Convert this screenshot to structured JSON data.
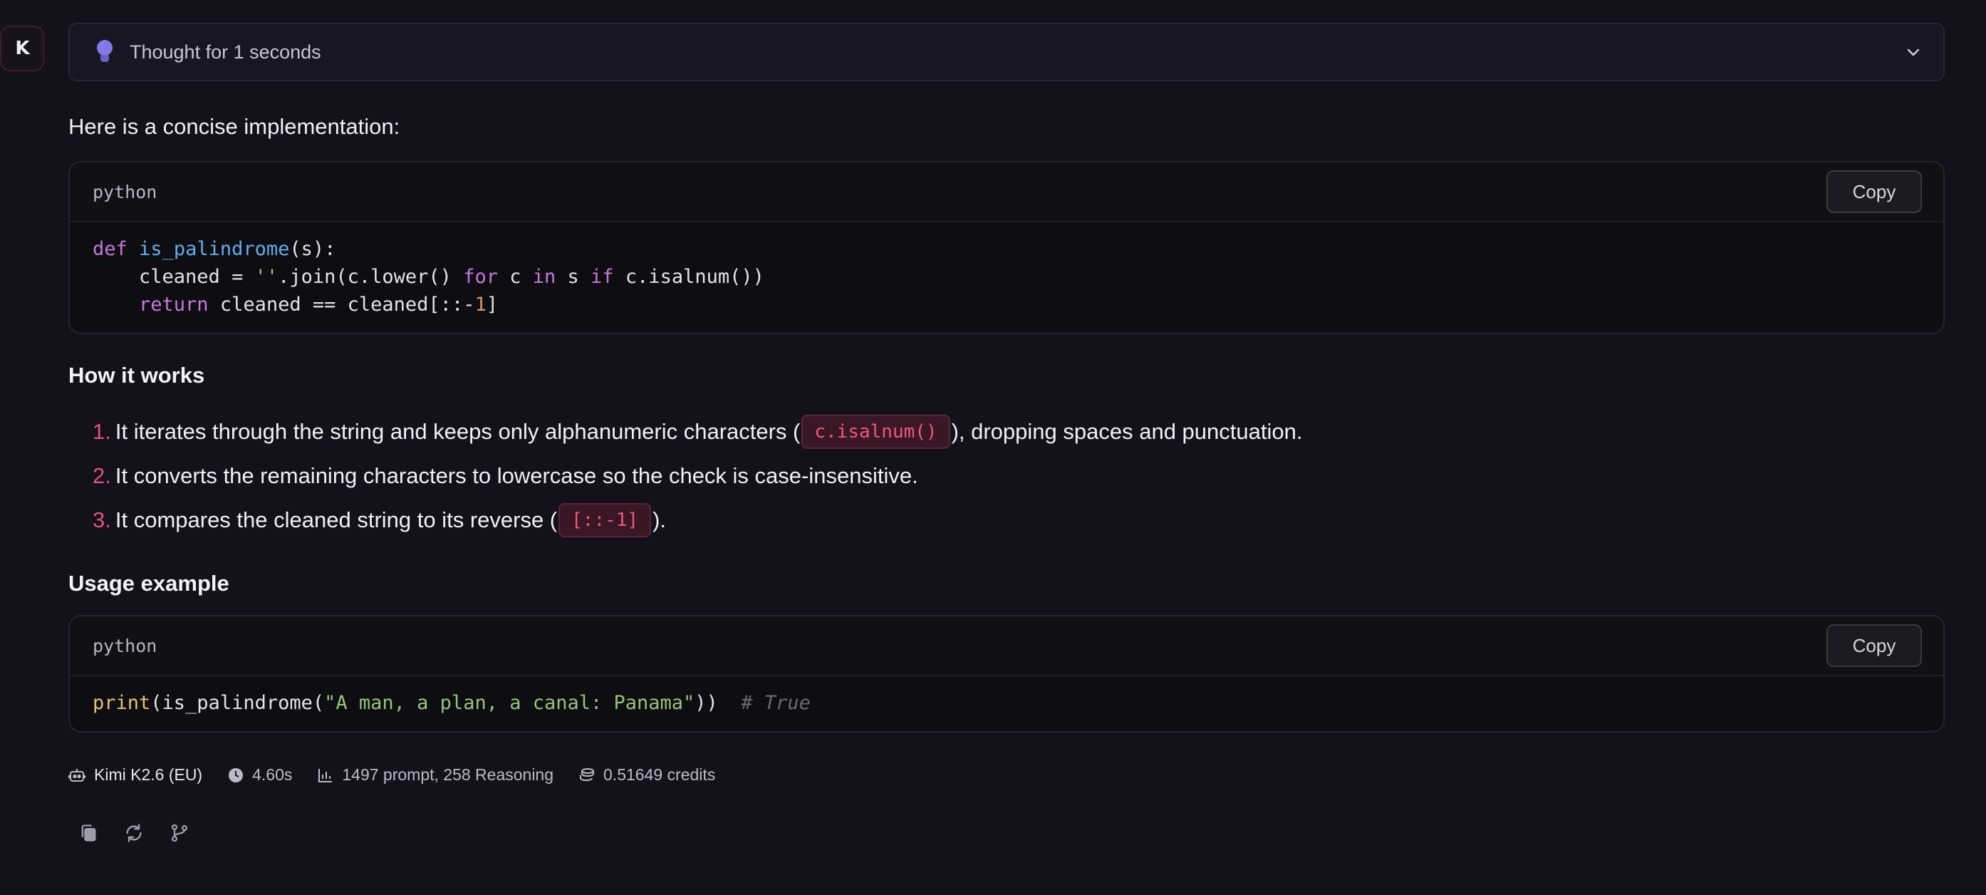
{
  "avatar": {
    "label": "K"
  },
  "thought": {
    "label": "Thought for 1 seconds"
  },
  "intro": "Here is a concise implementation:",
  "code_blocks": [
    {
      "language": "python",
      "copy_label": "Copy",
      "lines": [
        "def is_palindrome(s):",
        "    cleaned = ''.join(c.lower() for c in s if c.isalnum())",
        "    return cleaned == cleaned[::-1]"
      ]
    },
    {
      "language": "python",
      "copy_label": "Copy",
      "lines": [
        "print(is_palindrome(\"A man, a plan, a canal: Panama\"))  # True"
      ]
    }
  ],
  "how_it_works": {
    "heading": "How it works",
    "items": [
      {
        "num": "1.",
        "before": "It iterates through the string and keeps only alphanumeric characters (",
        "code": "c.isalnum()",
        "after": "), dropping spaces and punctuation."
      },
      {
        "num": "2.",
        "text": "It converts the remaining characters to lowercase so the check is case-insensitive."
      },
      {
        "num": "3.",
        "before": "It compares the cleaned string to its reverse (",
        "code": "[::-1]",
        "after": ")."
      }
    ]
  },
  "usage": {
    "heading": "Usage example"
  },
  "stats": {
    "model": "Kimi K2.6 (EU)",
    "time": "4.60s",
    "tokens": "1497 prompt, 258 Reasoning",
    "credits": "0.51649 credits"
  },
  "actions": {
    "icons": [
      "copy-icon",
      "regenerate-icon",
      "branch-icon"
    ]
  },
  "colors": {
    "background": "#13121c",
    "accent_list": "#ea4f7b",
    "inline_code": "#f0557f",
    "bulb": "#8579e6"
  }
}
